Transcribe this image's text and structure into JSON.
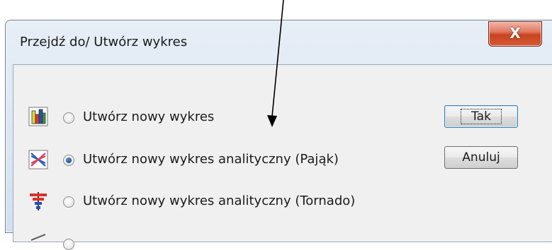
{
  "dialog": {
    "title": "Przejdź do/ Utwórz wykres",
    "close_label": "X"
  },
  "options": [
    {
      "label": "Utwórz nowy wykres",
      "icon": "bar-chart-icon",
      "selected": false
    },
    {
      "label": "Utwórz nowy wykres analityczny (Pająk)",
      "icon": "spider-chart-icon",
      "selected": true
    },
    {
      "label": "Utwórz nowy wykres analityczny (Tornado)",
      "icon": "tornado-chart-icon",
      "selected": false
    }
  ],
  "buttons": {
    "ok_label": "Tak",
    "cancel_label": "Anuluj"
  }
}
